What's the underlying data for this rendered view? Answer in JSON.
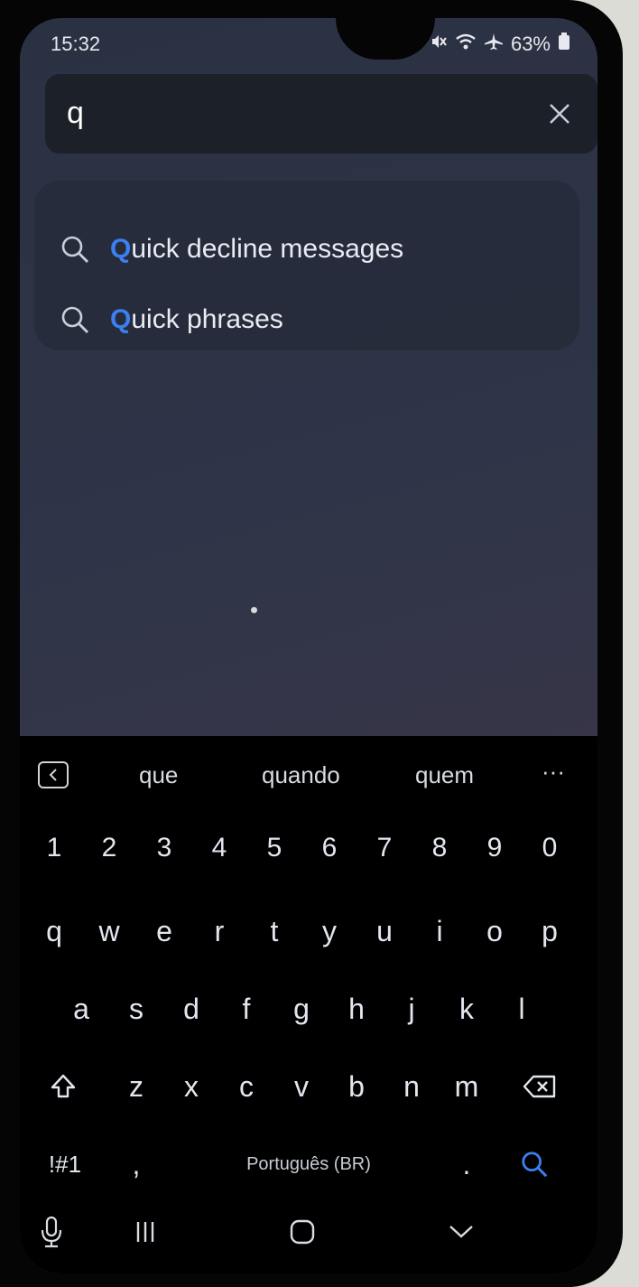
{
  "status_bar": {
    "time": "15:32",
    "battery": "63%",
    "icons": [
      "mute-icon",
      "wifi-icon",
      "airplane-icon",
      "battery-icon"
    ]
  },
  "search": {
    "value": "q",
    "clear_icon": "close-icon"
  },
  "suggestions": [
    {
      "highlight": "Q",
      "rest": "uick decline messages"
    },
    {
      "highlight": "Q",
      "rest": "uick phrases"
    }
  ],
  "keyboard": {
    "suggestion_bar": {
      "words": [
        "que",
        "quando",
        "quem"
      ],
      "more_label": "···"
    },
    "number_row": [
      "1",
      "2",
      "3",
      "4",
      "5",
      "6",
      "7",
      "8",
      "9",
      "0"
    ],
    "row1": [
      "q",
      "w",
      "e",
      "r",
      "t",
      "y",
      "u",
      "i",
      "o",
      "p"
    ],
    "row2": [
      "a",
      "s",
      "d",
      "f",
      "g",
      "h",
      "j",
      "k",
      "l"
    ],
    "row3": [
      "z",
      "x",
      "c",
      "v",
      "b",
      "n",
      "m"
    ],
    "symbols_label": "!#1",
    "comma_label": ",",
    "space_label": "Português (BR)",
    "period_label": ".",
    "accent_color": "#3d7ef0"
  },
  "navbar": {
    "icons": [
      "microphone-icon",
      "recent-apps-icon",
      "home-icon",
      "hide-keyboard-icon"
    ]
  }
}
